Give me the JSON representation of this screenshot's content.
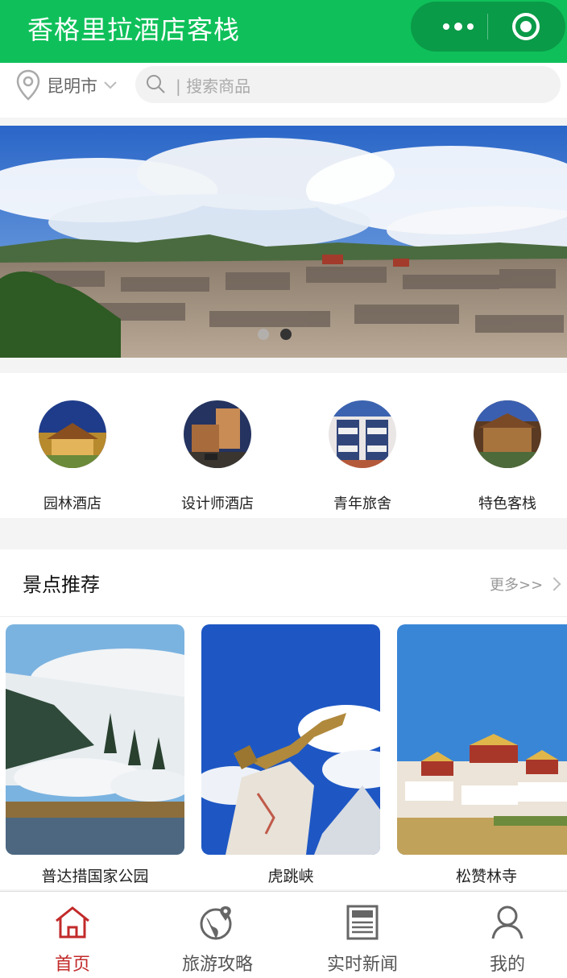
{
  "header": {
    "title": "香格里拉酒店客栈"
  },
  "location": {
    "city": "昆明市"
  },
  "search": {
    "placeholder": "| 搜索商品"
  },
  "banner": {
    "slide_count": 2,
    "active_slide": 2
  },
  "categories": [
    {
      "label": "园林酒店"
    },
    {
      "label": "设计师酒店"
    },
    {
      "label": "青年旅舍"
    },
    {
      "label": "特色客栈"
    }
  ],
  "recommend": {
    "title": "景点推荐",
    "more": "更多>>",
    "spots": [
      {
        "name": "普达措国家公园"
      },
      {
        "name": "虎跳峡"
      },
      {
        "name": "松赞林寺"
      }
    ]
  },
  "tabs": [
    {
      "label": "首页",
      "icon": "home-icon",
      "active": true
    },
    {
      "label": "旅游攻略",
      "icon": "globe-pin-icon",
      "active": false
    },
    {
      "label": "实时新闻",
      "icon": "newspaper-icon",
      "active": false
    },
    {
      "label": "我的",
      "icon": "user-icon",
      "active": false
    }
  ],
  "colors": {
    "brand": "#0fc05a",
    "capsule": "#0a9b48",
    "active_tab": "#c22a2a"
  }
}
